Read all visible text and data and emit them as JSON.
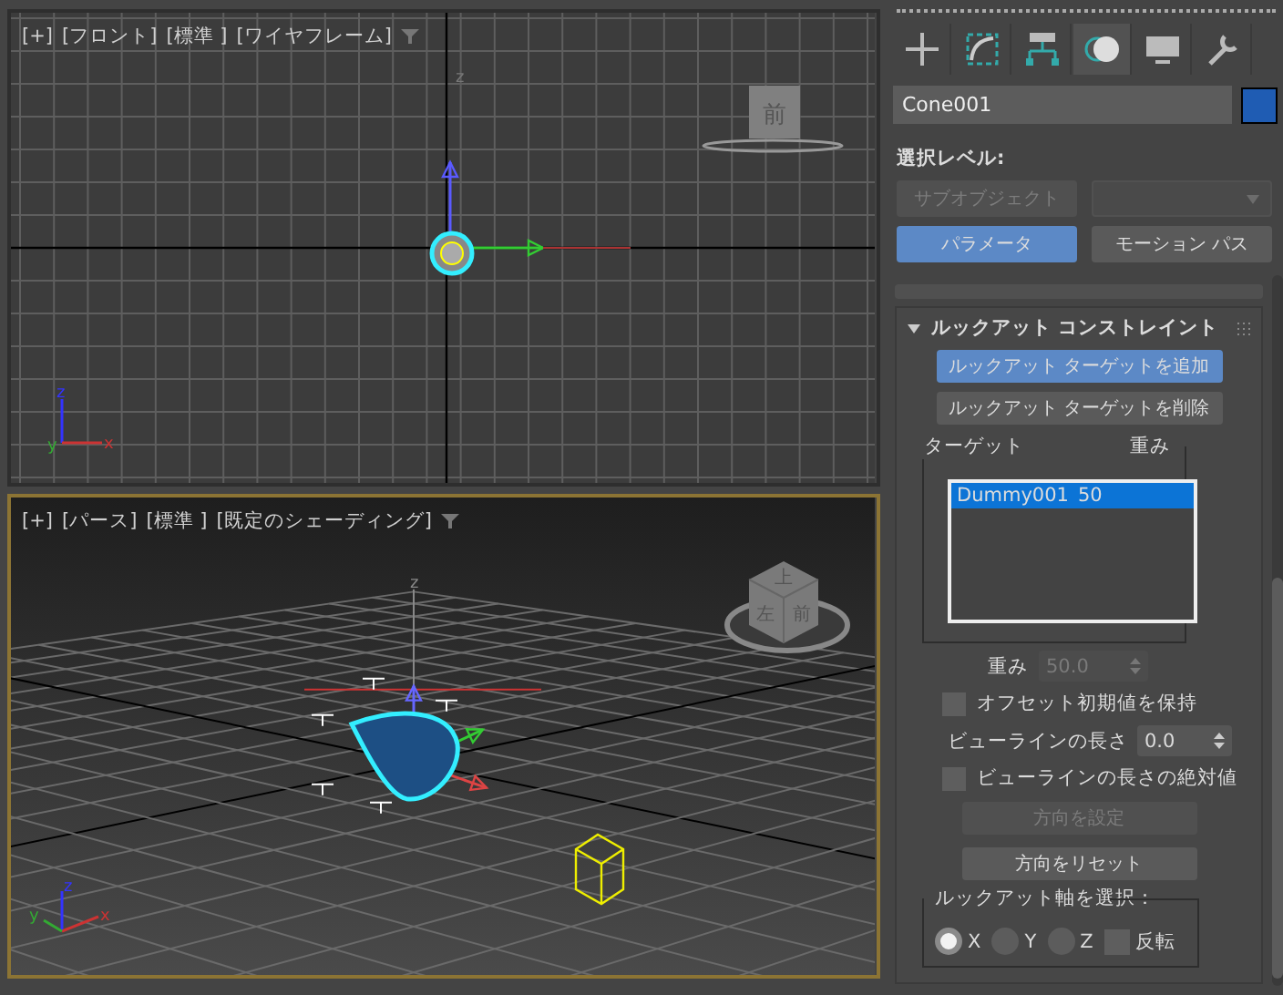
{
  "viewports": [
    {
      "kind": "front",
      "active": false,
      "labels": [
        "[+]",
        "[フロント]",
        "[標準 ]",
        "[ワイヤフレーム]"
      ],
      "viewcube_faces": [
        "前"
      ],
      "grid_axis_letter": "z",
      "axis_letters": [
        "z",
        "y",
        "x"
      ]
    },
    {
      "kind": "perspective",
      "active": true,
      "labels": [
        "[+]",
        "[パース]",
        "[標準 ]",
        "[既定のシェーディング]"
      ],
      "viewcube_faces": [
        "上",
        "左",
        "前"
      ],
      "grid_axis_letter": "z",
      "axis_letters": [
        "z",
        "y",
        "x"
      ]
    }
  ],
  "command_panel": {
    "tabs": [
      {
        "kind": "create",
        "selected": false
      },
      {
        "kind": "modify",
        "selected": false
      },
      {
        "kind": "hierarchy",
        "selected": false
      },
      {
        "kind": "motion",
        "selected": true
      },
      {
        "kind": "display",
        "selected": false
      },
      {
        "kind": "utilities",
        "selected": false
      }
    ],
    "object_name": "Cone001",
    "selection_level": {
      "label": "選択レベル:",
      "subobject_button": {
        "label": "サブオブジェクト",
        "disabled": true
      },
      "dropdown": {
        "disabled": true
      }
    },
    "mode_buttons": [
      {
        "label": "パラメータ",
        "selected": true
      },
      {
        "label": "モーション パス",
        "selected": false
      }
    ],
    "rollout": {
      "title": "ルックアット コンストレイント",
      "expanded": true,
      "target_buttons": [
        {
          "label": "ルックアット ターゲットを追加",
          "selected": true
        },
        {
          "label": "ルックアット ターゲットを削除",
          "selected": false
        }
      ],
      "target_list": {
        "columns": [
          "ターゲット",
          "重み"
        ],
        "rows": [
          {
            "cells": [
              "Dummy001",
              "50"
            ],
            "selected": true
          }
        ]
      },
      "weight": {
        "label": "重み",
        "value": "50.0",
        "disabled": true
      },
      "keep_offset": {
        "label": "オフセット初期値を保持",
        "checked": false
      },
      "viewline_length": {
        "label": "ビューラインの長さ",
        "value": "0.0"
      },
      "absolute_viewline": {
        "label": "ビューラインの長さの絶対値",
        "checked": false
      },
      "orientation_buttons": [
        {
          "label": "方向を設定",
          "disabled": true
        },
        {
          "label": "方向をリセット",
          "disabled": false
        }
      ],
      "axis": {
        "title": "ルックアット軸を選択：",
        "options": [
          {
            "label": "X",
            "selected": true
          },
          {
            "label": "Y",
            "selected": false
          },
          {
            "label": "Z",
            "selected": false
          }
        ],
        "flip": {
          "label": "反転",
          "checked": false
        }
      }
    }
  }
}
